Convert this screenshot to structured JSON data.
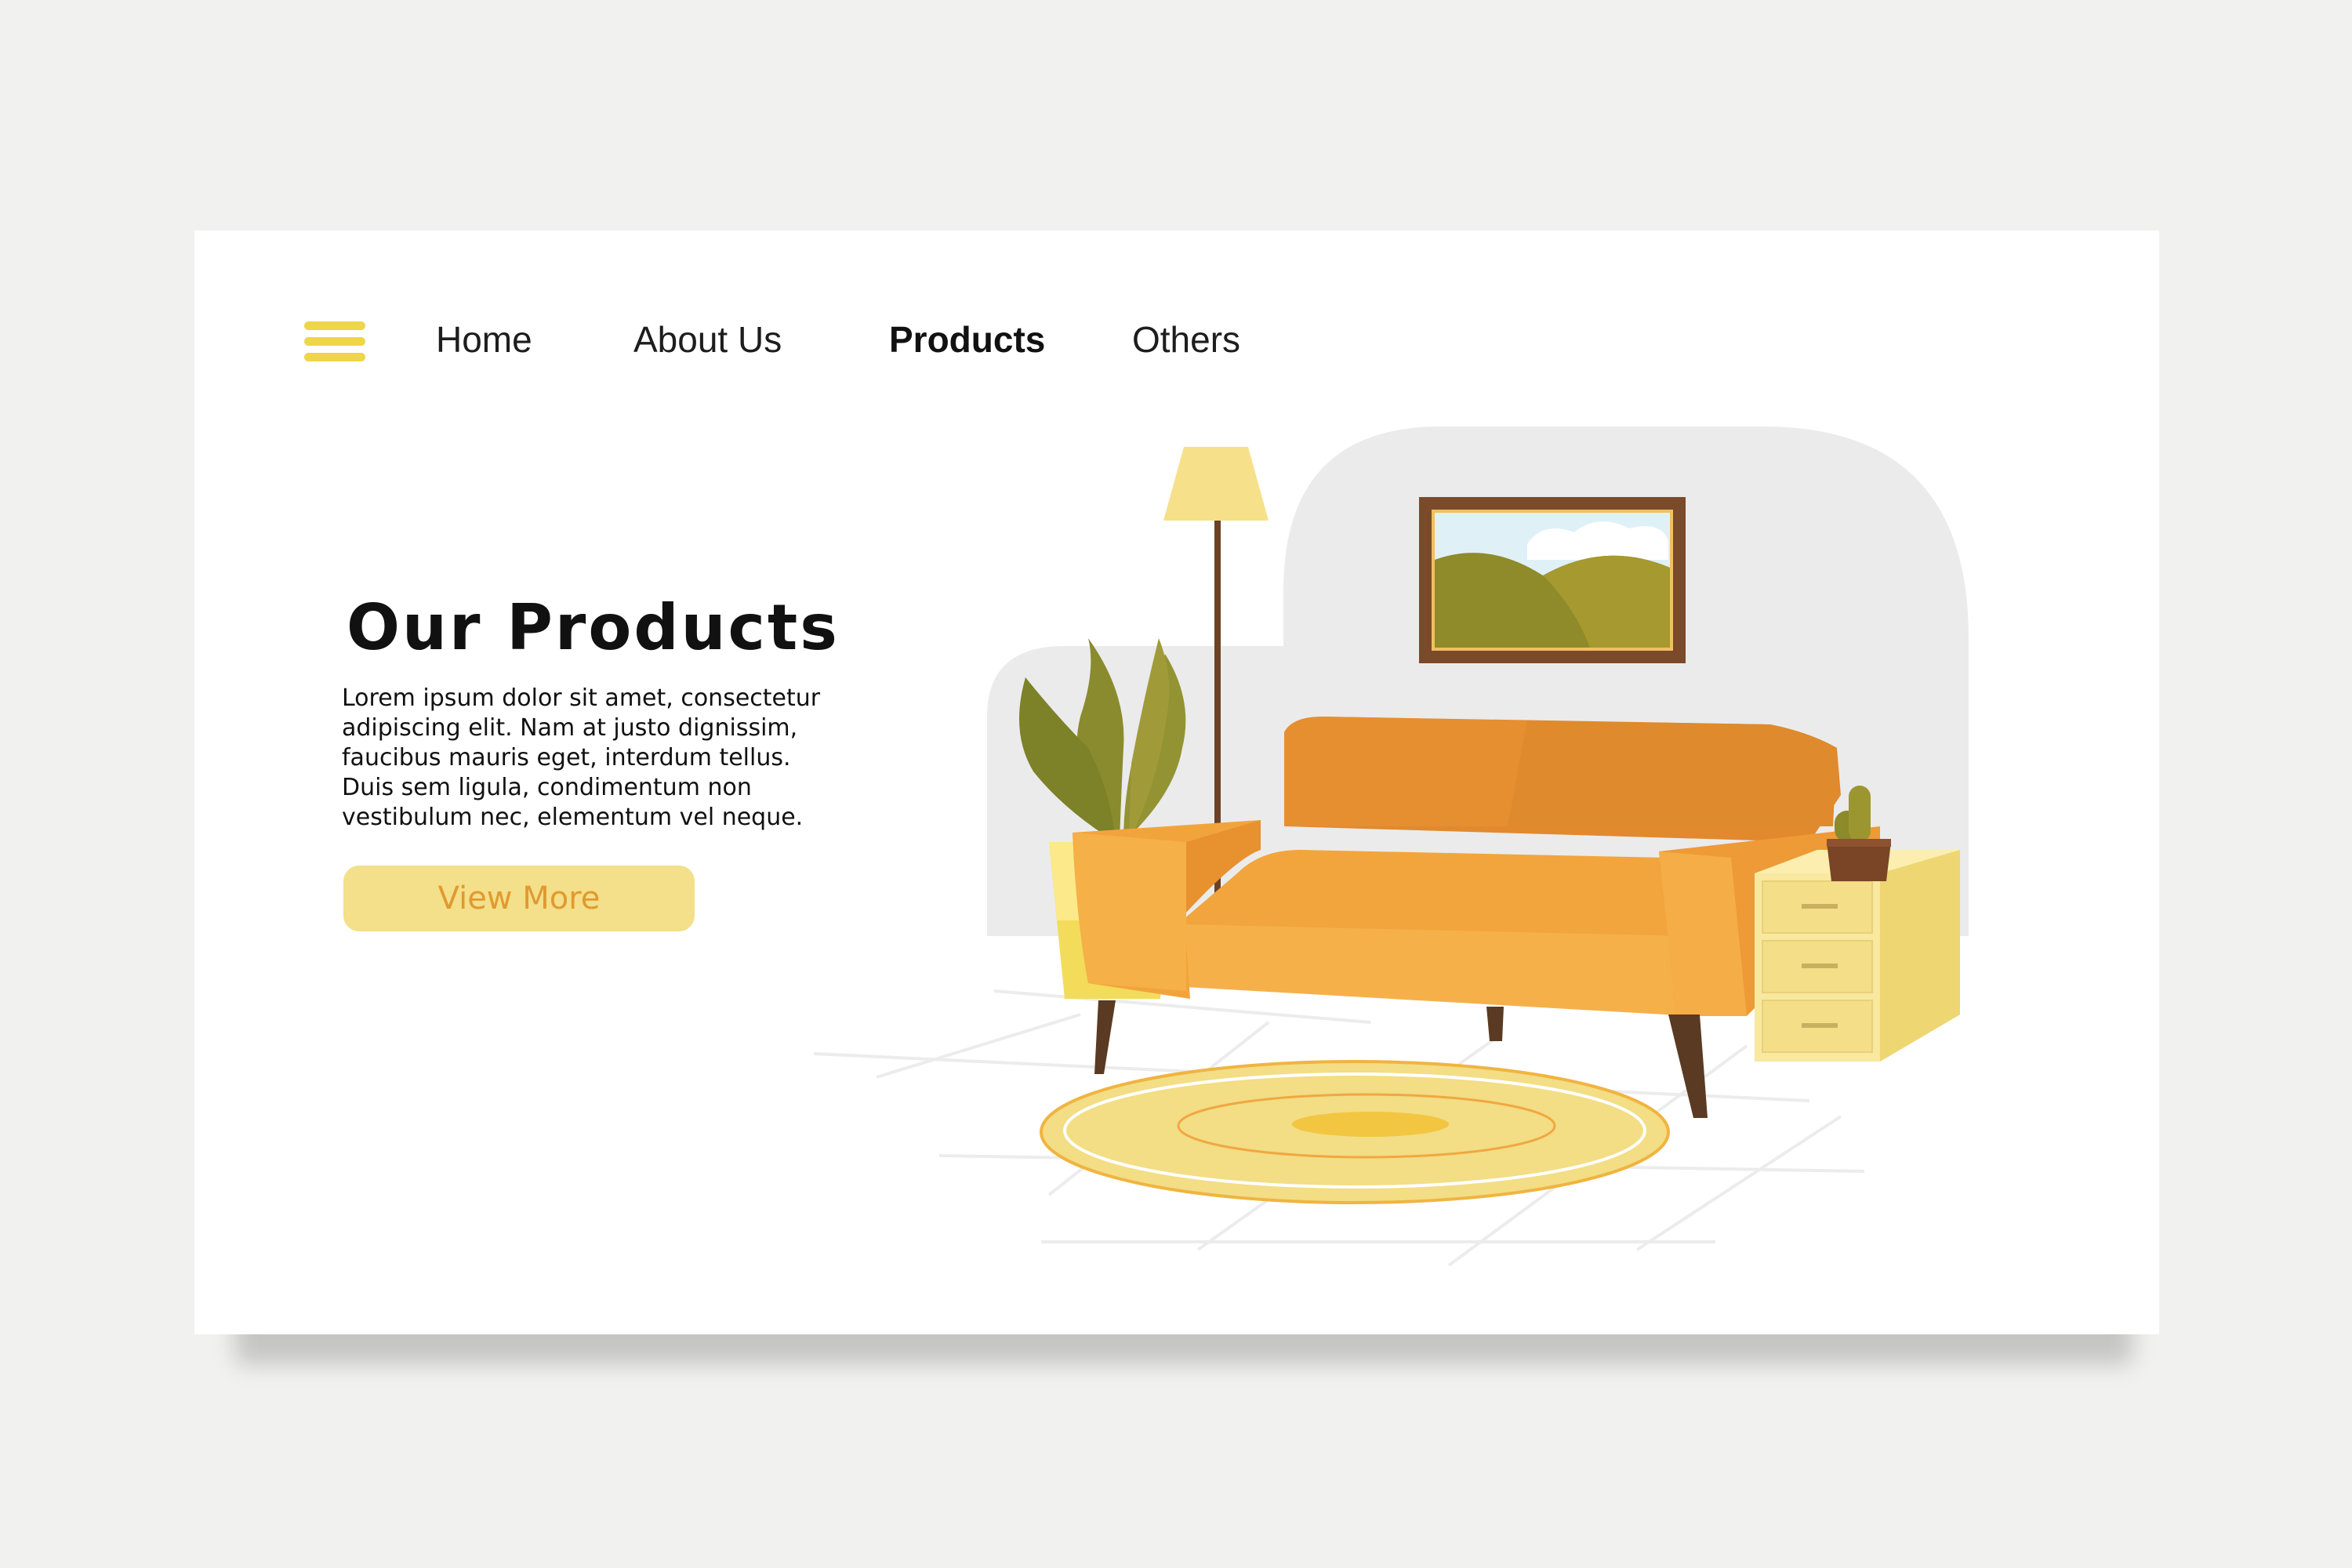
{
  "nav": {
    "items": [
      {
        "label": "Home",
        "active": false
      },
      {
        "label": "About Us",
        "active": false
      },
      {
        "label": "Products",
        "active": true
      },
      {
        "label": "Others",
        "active": false
      }
    ]
  },
  "hero": {
    "title": "Our Products",
    "description": "Lorem ipsum dolor sit amet, consectetur adipiscing elit. Nam at justo dignissim, faucibus mauris eget, interdum tellus. Duis sem ligula, condimentum non vestibulum nec, elementum vel neque.",
    "button_label": "View More"
  },
  "icons": {
    "menu": "hamburger-menu-icon"
  },
  "colors": {
    "accent_yellow": "#eed54a",
    "button_bg": "#f4df8a",
    "button_text": "#e09a2f",
    "sofa_orange": "#f0a63b",
    "background": "#f1f1f0"
  }
}
